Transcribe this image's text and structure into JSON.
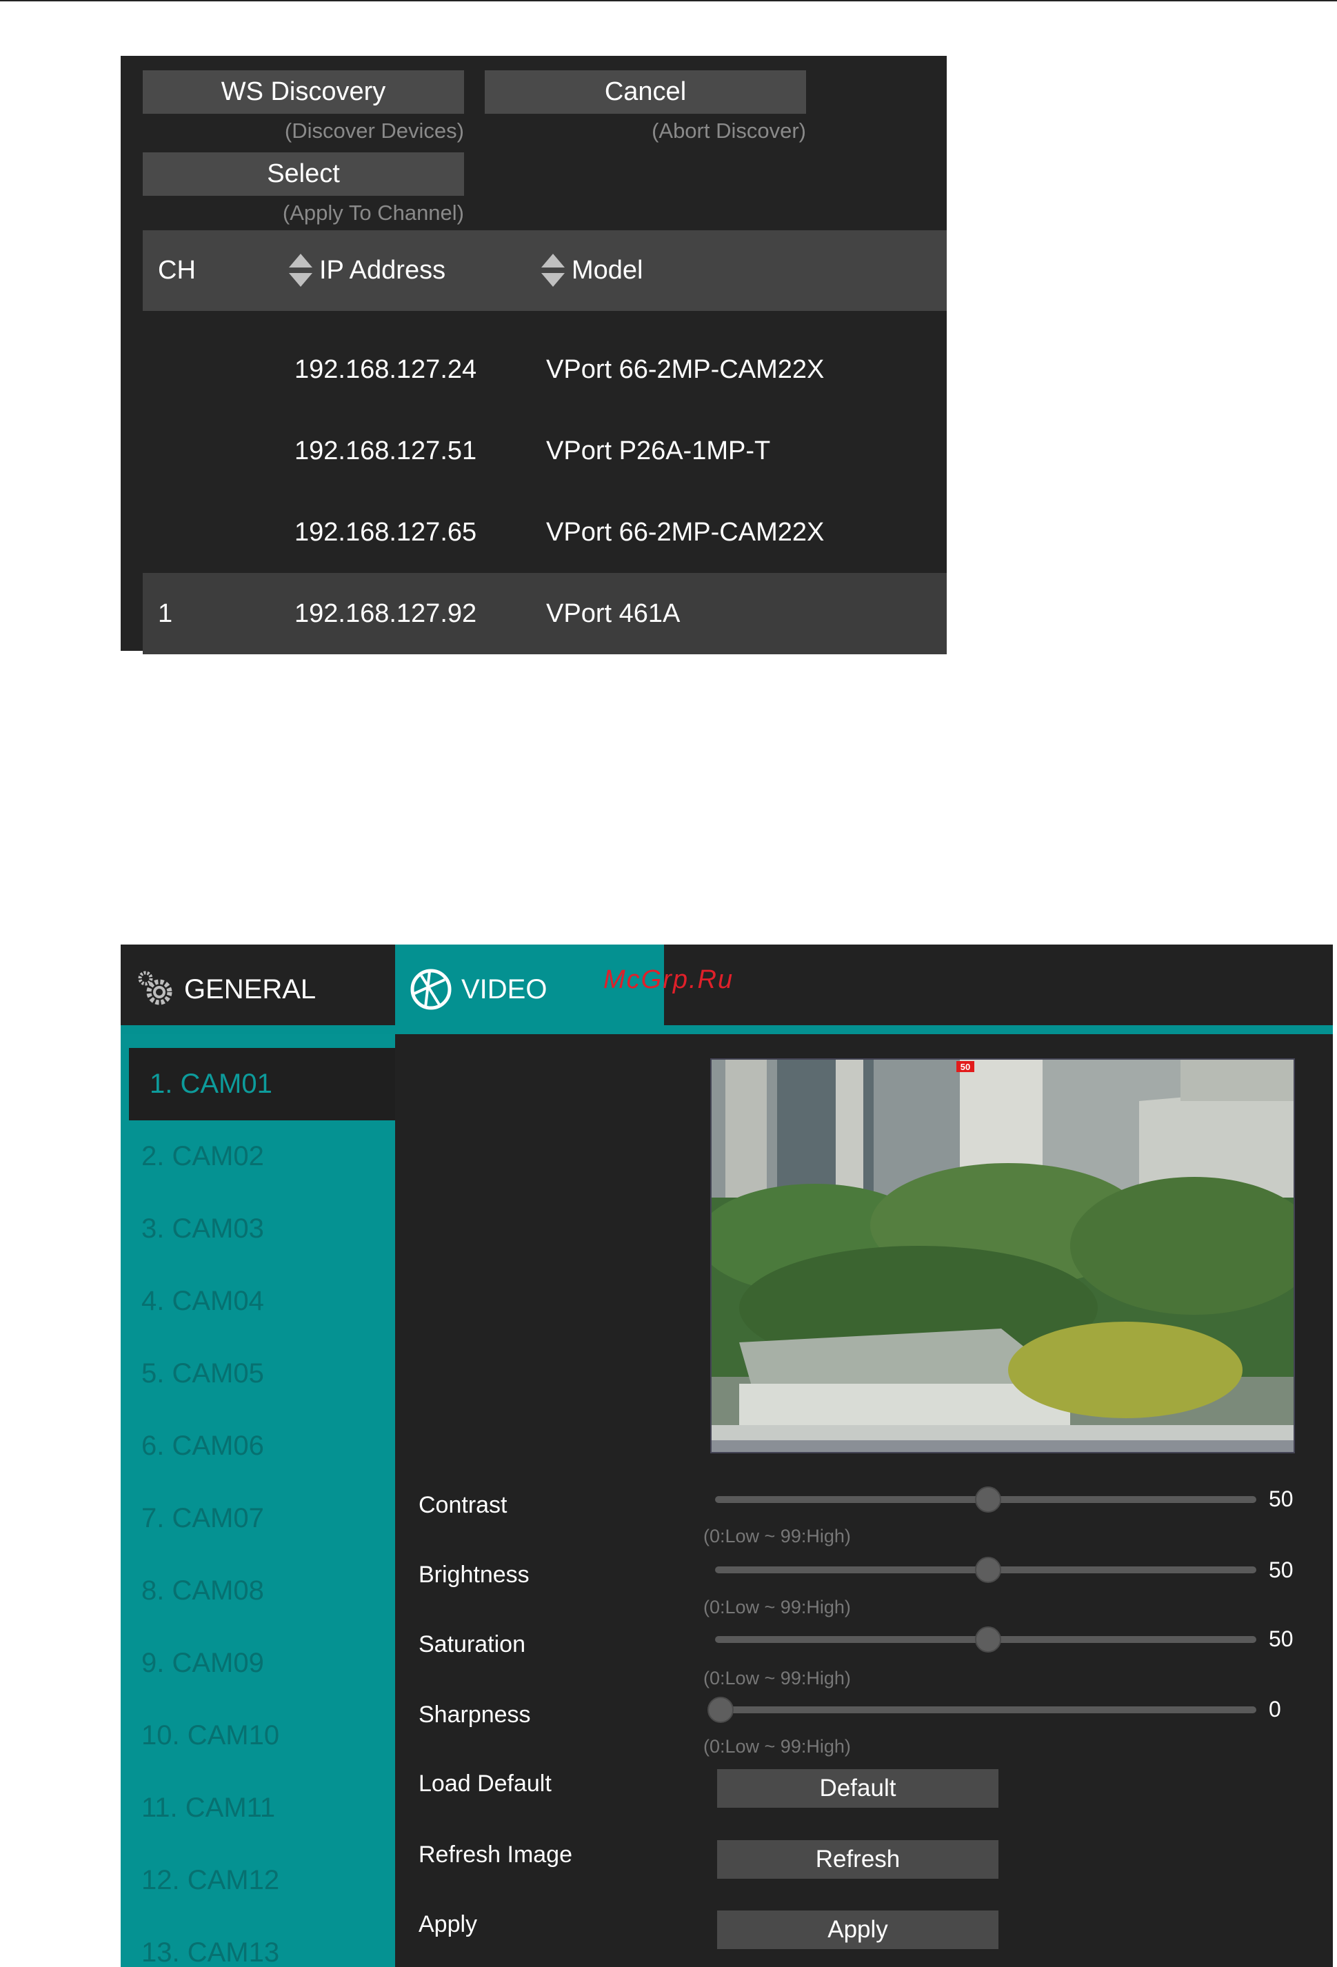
{
  "discovery": {
    "ws_discovery_label": "WS Discovery",
    "ws_discovery_sub": "(Discover Devices)",
    "cancel_label": "Cancel",
    "cancel_sub": "(Abort Discover)",
    "select_label": "Select",
    "select_sub": "(Apply To Channel)",
    "columns": {
      "ch": "CH",
      "ip": "IP Address",
      "model": "Model"
    },
    "rows": [
      {
        "ch": "",
        "ip": "192.168.127.24",
        "model": "VPort 66-2MP-CAM22X",
        "selected": false
      },
      {
        "ch": "",
        "ip": "192.168.127.51",
        "model": "VPort P26A-1MP-T",
        "selected": false
      },
      {
        "ch": "",
        "ip": "192.168.127.65",
        "model": "VPort 66-2MP-CAM22X",
        "selected": false
      },
      {
        "ch": "1",
        "ip": "192.168.127.92",
        "model": "VPort 461A",
        "selected": true
      }
    ]
  },
  "settings": {
    "tabs": [
      {
        "label": "GENERAL",
        "icon": "gear-icon",
        "active": false
      },
      {
        "label": "VIDEO",
        "icon": "aperture-icon",
        "active": true
      }
    ],
    "watermark": "McGrp.Ru",
    "cameras": [
      "1. CAM01",
      "2. CAM02",
      "3. CAM03",
      "4. CAM04",
      "5. CAM05",
      "6. CAM06",
      "7. CAM07",
      "8. CAM08",
      "9. CAM09",
      "10. CAM10",
      "11. CAM11",
      "12. CAM12",
      "13. CAM13"
    ],
    "active_camera": 0,
    "preview_badge": "50",
    "sliders": [
      {
        "label": "Contrast",
        "value": 50,
        "range": "(0:Low ~ 99:High)"
      },
      {
        "label": "Brightness",
        "value": 50,
        "range": "(0:Low ~ 99:High)"
      },
      {
        "label": "Saturation",
        "value": 50,
        "range": "(0:Low ~ 99:High)"
      },
      {
        "label": "Sharpness",
        "value": 0,
        "range": "(0:Low ~ 99:High)"
      }
    ],
    "actions": [
      {
        "label": "Load Default",
        "button": "Default"
      },
      {
        "label": "Refresh Image",
        "button": "Refresh"
      },
      {
        "label": "Apply",
        "button": "Apply"
      }
    ],
    "colors": {
      "accent": "#049191",
      "panel": "#222222",
      "button": "#4a4a4a"
    }
  }
}
